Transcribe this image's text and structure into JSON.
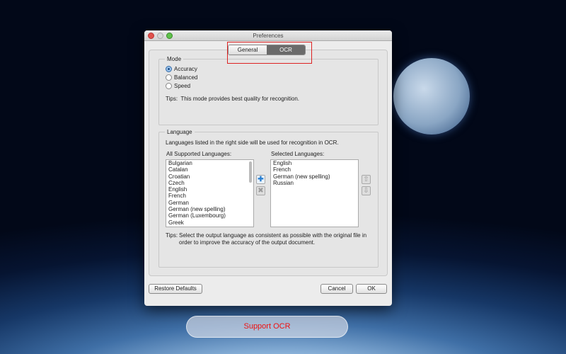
{
  "window": {
    "title": "Preferences"
  },
  "tabs": [
    {
      "label": "General",
      "selected": false
    },
    {
      "label": "OCR",
      "selected": true
    }
  ],
  "mode": {
    "legend": "Mode",
    "options": [
      "Accuracy",
      "Balanced",
      "Speed"
    ],
    "selected": "Accuracy",
    "tips_label": "Tips:",
    "tips": "This mode provides best quality for recognition."
  },
  "language": {
    "legend": "Language",
    "description": "Languages listed in the right side will be used for recognition in OCR.",
    "all_label": "All Supported Languages:",
    "all": [
      "Bulgarian",
      "Catalan",
      "Croatian",
      "Czech",
      "English",
      "French",
      "German",
      "German (new spelling)",
      "German (Luxembourg)",
      "Greek"
    ],
    "selected_label": "Selected Languages:",
    "selected": [
      "English",
      "French",
      "German (new spelling)",
      "Russian"
    ],
    "tips_label": "Tips:",
    "tips": "Select the output language as consistent as possible with the original file in order to improve the accuracy of the output document."
  },
  "buttons": {
    "restore": "Restore Defaults",
    "cancel": "Cancel",
    "ok": "OK"
  },
  "support": "Support OCR",
  "colors": {
    "highlight": "#dd2222",
    "support_text": "#ee1111"
  }
}
